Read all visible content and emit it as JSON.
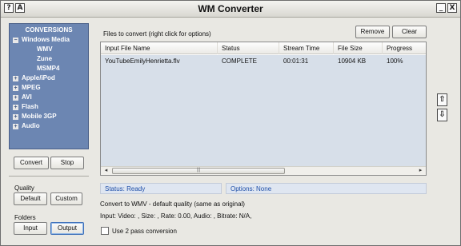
{
  "window": {
    "title": "WM Converter",
    "help_button": "?",
    "about_button": "A",
    "minimize_button": "_",
    "close_button": "X"
  },
  "sidebar": {
    "title": "CONVERSIONS",
    "expanded_item": {
      "label": "Windows Media",
      "toggle": "−",
      "children": [
        "WMV",
        "Zune",
        "MSMP4"
      ]
    },
    "items": [
      {
        "label": "Apple/iPod",
        "toggle": "+"
      },
      {
        "label": "MPEG",
        "toggle": "+"
      },
      {
        "label": "AVI",
        "toggle": "+"
      },
      {
        "label": "Flash",
        "toggle": "+"
      },
      {
        "label": "Mobile 3GP",
        "toggle": "+"
      },
      {
        "label": "Audio",
        "toggle": "+"
      }
    ],
    "convert_label": "Convert",
    "stop_label": "Stop",
    "quality_label": "Quality",
    "default_label": "Default",
    "custom_label": "Custom",
    "folders_label": "Folders",
    "input_label": "Input",
    "output_label": "Output"
  },
  "files": {
    "label": "Files to convert (right click for options)",
    "remove_label": "Remove",
    "clear_label": "Clear",
    "columns": [
      "Input File Name",
      "Status",
      "Stream Time",
      "File Size",
      "Progress"
    ],
    "rows": [
      {
        "name": "YouTubeEmilyHenrietta.flv",
        "status": "COMPLETE",
        "stream_time": "00:01:31",
        "size": "10904 KB",
        "progress": "100%"
      }
    ],
    "scroll_left": "◂",
    "scroll_right": "▸",
    "scroll_grip": "|||"
  },
  "order": {
    "up_icon": "⇧",
    "down_icon": "⇩"
  },
  "status": {
    "status_text": "Status: Ready",
    "options_text": "Options: None",
    "convert_to": "Convert to WMV - default quality (same as original)",
    "input_info": "Input: Video: , Size: , Rate: 0.00, Audio: , Bitrate: N/A,",
    "two_pass_label": "Use 2 pass conversion"
  }
}
